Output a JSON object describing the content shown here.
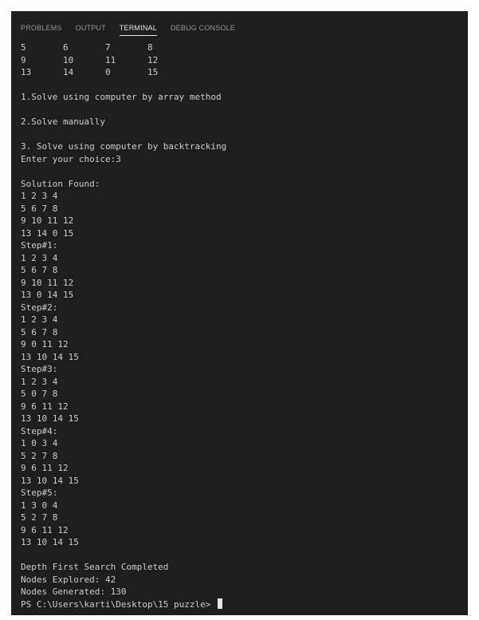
{
  "tabs": [
    {
      "label": "PROBLEMS",
      "active": false
    },
    {
      "label": "OUTPUT",
      "active": false
    },
    {
      "label": "TERMINAL",
      "active": true
    },
    {
      "label": "DEBUG CONSOLE",
      "active": false
    }
  ],
  "terminal": {
    "lines": [
      "5       6       7       8",
      "9       10      11      12",
      "13      14      0       15",
      "",
      "1.Solve using computer by array method",
      "",
      "2.Solve manually",
      "",
      "3. Solve using computer by backtracking",
      "Enter your choice:3",
      "",
      "Solution Found:",
      "1 2 3 4",
      "5 6 7 8",
      "9 10 11 12",
      "13 14 0 15",
      "Step#1:",
      "1 2 3 4",
      "5 6 7 8",
      "9 10 11 12",
      "13 0 14 15",
      "Step#2:",
      "1 2 3 4",
      "5 6 7 8",
      "9 0 11 12",
      "13 10 14 15",
      "Step#3:",
      "1 2 3 4",
      "5 0 7 8",
      "9 6 11 12",
      "13 10 14 15",
      "Step#4:",
      "1 0 3 4",
      "5 2 7 8",
      "9 6 11 12",
      "13 10 14 15",
      "Step#5:",
      "1 3 0 4",
      "5 2 7 8",
      "9 6 11 12",
      "13 10 14 15",
      "",
      "Depth First Search Completed",
      "Nodes Explored: 42",
      "Nodes Generated: 130"
    ],
    "prompt": "PS C:\\Users\\karti\\Desktop\\15 puzzle> "
  }
}
